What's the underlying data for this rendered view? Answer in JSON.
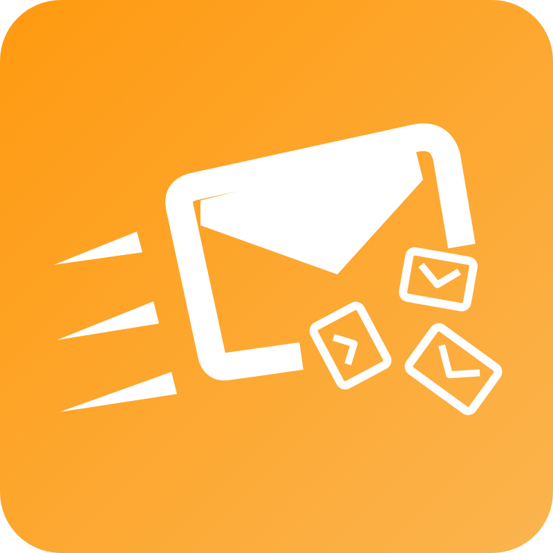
{
  "icon": {
    "name": "bulk-email-send-icon",
    "description_glyphs": [
      "envelope-icon",
      "speed-lines-icon",
      "small-envelope-icon"
    ],
    "colors": {
      "gradient_start": "#FF9A10",
      "gradient_end": "#FBB44E",
      "foreground": "#FFFFFF"
    }
  }
}
